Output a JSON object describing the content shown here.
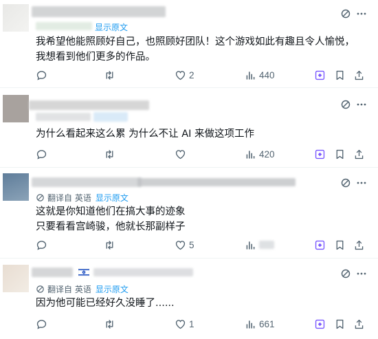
{
  "ui": {
    "show_original": "显示原文",
    "translated_from": "翻译自 英语",
    "accent": "#1d9bf0",
    "grok_color": "#7856ff",
    "muted": "#536471"
  },
  "posts": [
    {
      "text": "我希望他能照顾好自己，也照顾好团队！这个游戏如此有趣且令人愉悦，我想看到他们更多的作品。",
      "replies": "",
      "likes": "2",
      "views": "440"
    },
    {
      "text": "为什么看起来这么累 为什么不让 AI 来做这项工作",
      "replies": "",
      "likes": "",
      "views": "420"
    },
    {
      "text": "这就是你知道他们在搞大事的迹象\n只要看看宫崎骏，他就长那副样子",
      "replies": "",
      "likes": "5",
      "views": ""
    },
    {
      "text": "因为他可能已经好久没睡了......",
      "replies": "",
      "likes": "1",
      "views": "661"
    }
  ]
}
